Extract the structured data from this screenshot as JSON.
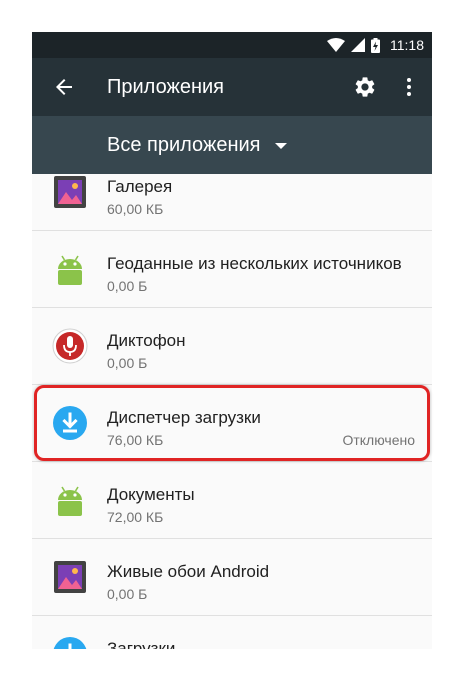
{
  "statusbar": {
    "time": "11:18"
  },
  "toolbar": {
    "title": "Приложения"
  },
  "filter": {
    "label": "Все приложения"
  },
  "apps": [
    {
      "name": "Галерея",
      "size": "60,00 КБ",
      "status": "",
      "icon": "gallery-icon"
    },
    {
      "name": "Геоданные из нескольких источников",
      "size": "0,00 Б",
      "status": "",
      "icon": "android-icon"
    },
    {
      "name": "Диктофон",
      "size": "0,00 Б",
      "status": "",
      "icon": "microphone-icon"
    },
    {
      "name": "Диспетчер загрузки",
      "size": "76,00 КБ",
      "status": "Отключено",
      "icon": "download-icon",
      "highlighted": true
    },
    {
      "name": "Документы",
      "size": "72,00 КБ",
      "status": "",
      "icon": "android-icon"
    },
    {
      "name": "Живые обои Android",
      "size": "0,00 Б",
      "status": "",
      "icon": "gallery-icon"
    },
    {
      "name": "Загрузки",
      "size": "",
      "status": "",
      "icon": "download-icon"
    }
  ],
  "colors": {
    "statusbar": "#1c2428",
    "toolbar": "#263238",
    "filterbar": "#37474f",
    "highlight": "#e02424",
    "android_green": "#8bc34a",
    "download_blue": "#29a8f0",
    "mic_red": "#c62828"
  }
}
